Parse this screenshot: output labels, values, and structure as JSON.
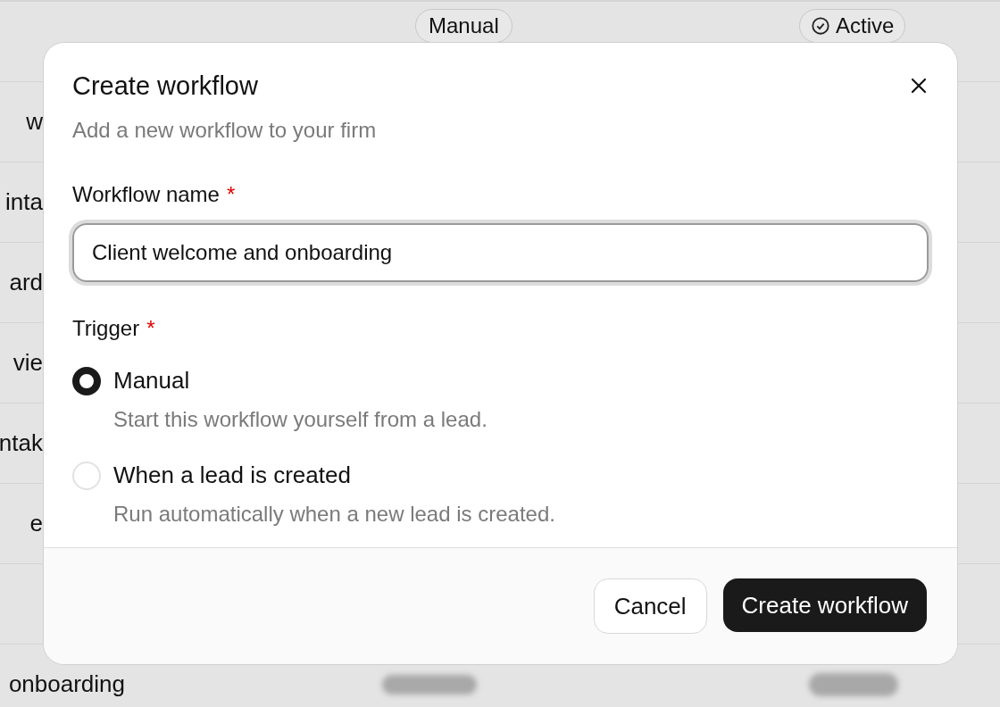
{
  "background_table": {
    "rows": [
      {
        "name": "",
        "trigger": "Manual",
        "status": "Active"
      },
      {
        "name": "w"
      },
      {
        "name": "inta"
      },
      {
        "name": "ard"
      },
      {
        "name": "vie"
      },
      {
        "name": "ntak"
      },
      {
        "name": "e"
      },
      {
        "name": ""
      },
      {
        "name": "onboarding",
        "blurred": true
      }
    ]
  },
  "dialog": {
    "title": "Create workflow",
    "subtitle": "Add a new workflow to your firm",
    "name_field": {
      "label": "Workflow name",
      "required_mark": "*",
      "value": "Client welcome and onboarding"
    },
    "trigger": {
      "label": "Trigger",
      "required_mark": "*",
      "options": [
        {
          "label": "Manual",
          "description": "Start this workflow yourself from a lead.",
          "selected": true
        },
        {
          "label": "When a lead is created",
          "description": "Run automatically when a new lead is created.",
          "selected": false
        }
      ]
    },
    "buttons": [
      {
        "label": "Cancel",
        "kind": "secondary"
      },
      {
        "label": "Create workflow",
        "kind": "primary"
      }
    ]
  }
}
